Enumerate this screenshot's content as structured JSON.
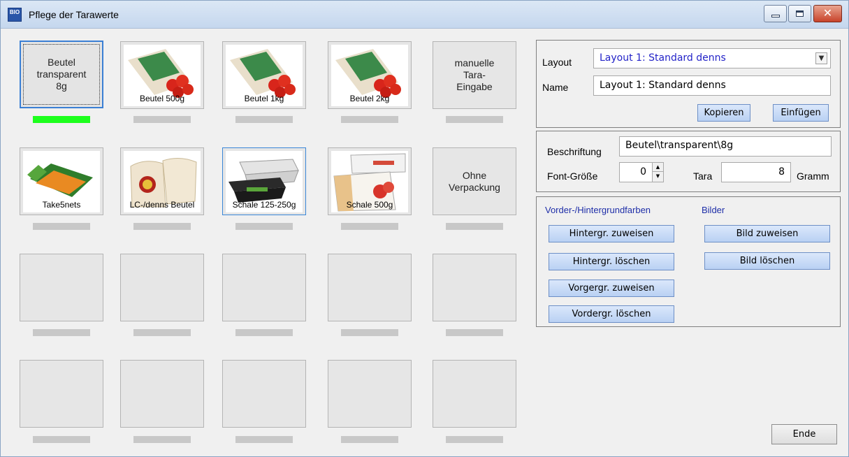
{
  "window": {
    "title": "Pflege der Tarawerte",
    "icon_text": "BIO",
    "icons": {
      "app": "bio-app-icon",
      "minimize": "minimize-icon",
      "maximize": "maximize-icon",
      "close": "close-icon"
    }
  },
  "tiles": [
    {
      "label": "Beutel\ntransparent\n8g",
      "type": "text",
      "selected": true,
      "bar": "green"
    },
    {
      "label": "Beutel 500g",
      "type": "image",
      "image": "tomato-bag-image"
    },
    {
      "label": "Beutel 1kg",
      "type": "image",
      "image": "tomato-bag-image"
    },
    {
      "label": "Beutel 2kg",
      "type": "image",
      "image": "tomato-bag-image"
    },
    {
      "label": "manuelle\nTara-\nEingabe",
      "type": "text"
    },
    {
      "label": "Take5nets",
      "type": "image",
      "image": "carrot-net-image"
    },
    {
      "label": "LC-/denns Beutel",
      "type": "image",
      "image": "cloth-bag-image"
    },
    {
      "label": "Schale 125-250g",
      "type": "image",
      "image": "tray-image",
      "highlight": true
    },
    {
      "label": "Schale 500g",
      "type": "image",
      "image": "tub-image"
    },
    {
      "label": "Ohne\nVerpackung",
      "type": "text"
    }
  ],
  "layout_group": {
    "layout_label": "Layout",
    "layout_value": "Layout 1: Standard denns",
    "name_label": "Name",
    "name_value": "Layout 1: Standard denns",
    "copy_button": "Kopieren",
    "paste_button": "Einfügen"
  },
  "label_group": {
    "caption_label": "Beschriftung",
    "caption_value": "Beutel\\transparent\\8g",
    "font_label": "Font-Größe",
    "font_value": "0",
    "tara_label": "Tara",
    "tara_value": "8",
    "unit_label": "Gramm"
  },
  "colors_group": {
    "colors_title": "Vorder-/Hintergrundfarben",
    "images_title": "Bilder",
    "bg_assign": "Hintergr. zuweisen",
    "bg_delete": "Hintergr. löschen",
    "fg_assign": "Vorgergr. zuweisen",
    "fg_delete": "Vordergr. löschen",
    "img_assign": "Bild zuweisen",
    "img_delete": "Bild löschen"
  },
  "footer": {
    "end_button": "Ende"
  },
  "colors": {
    "accent_blue": "#3a7fd4",
    "indicator_green": "#1dff1d",
    "link_blue": "#1e2ea8"
  }
}
